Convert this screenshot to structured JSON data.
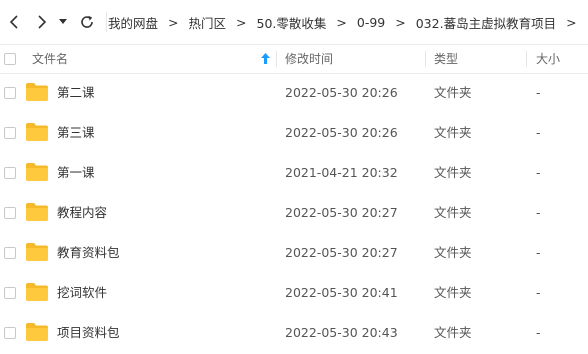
{
  "nav": {
    "back_icon": "chevron-left-icon",
    "forward_icon": "chevron-right-icon",
    "dropdown_icon": "caret-down-icon",
    "refresh_icon": "refresh-icon"
  },
  "breadcrumb": [
    {
      "label": "我的网盘"
    },
    {
      "label": "热门区"
    },
    {
      "label": "50.零散收集"
    },
    {
      "label": "0-99"
    },
    {
      "label": "032.蕃岛主虚拟教育项目"
    }
  ],
  "breadcrumb_separator": ">",
  "table": {
    "columns": {
      "name": "文件名",
      "modified": "修改时间",
      "type": "类型",
      "size": "大小"
    },
    "sort_icon": "sort-up-arrow-icon",
    "rows": [
      {
        "name": "第二课",
        "modified": "2022-05-30 20:26",
        "type": "文件夹",
        "size": "-"
      },
      {
        "name": "第三课",
        "modified": "2022-05-30 20:26",
        "type": "文件夹",
        "size": "-"
      },
      {
        "name": "第一课",
        "modified": "2021-04-21 20:32",
        "type": "文件夹",
        "size": "-"
      },
      {
        "name": "教程内容",
        "modified": "2022-05-30 20:27",
        "type": "文件夹",
        "size": "-"
      },
      {
        "name": "教育资料包",
        "modified": "2022-05-30 20:27",
        "type": "文件夹",
        "size": "-"
      },
      {
        "name": "挖词软件",
        "modified": "2022-05-30 20:41",
        "type": "文件夹",
        "size": "-"
      },
      {
        "name": "项目资料包",
        "modified": "2022-05-30 20:43",
        "type": "文件夹",
        "size": "-"
      }
    ]
  },
  "colors": {
    "folder": "#ffc93d",
    "folder_tab": "#f5b92a",
    "sort_arrow": "#1a9bff",
    "text": "#333333"
  }
}
